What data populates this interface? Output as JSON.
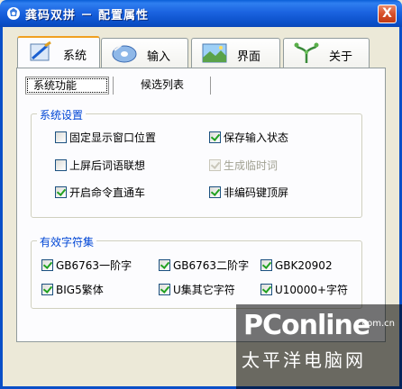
{
  "window": {
    "title": "龚码双拼 － 配置属性",
    "close_label": "X"
  },
  "tabs": [
    {
      "label": "系统",
      "icon": "pen-paper-icon",
      "active": true
    },
    {
      "label": "输入",
      "icon": "disc-icon",
      "active": false
    },
    {
      "label": "界面",
      "icon": "landscape-icon",
      "active": false
    },
    {
      "label": "关于",
      "icon": "vine-icon",
      "active": false
    }
  ],
  "subtabs": [
    {
      "label": "系统功能",
      "active": true
    },
    {
      "label": "候选列表",
      "active": false
    }
  ],
  "system_settings": {
    "title": "系统设置",
    "options": [
      {
        "label": "固定显示窗口位置",
        "checked": false,
        "enabled": true
      },
      {
        "label": "保存输入状态",
        "checked": true,
        "enabled": true
      },
      {
        "label": "上屏后词语联想",
        "checked": false,
        "enabled": true
      },
      {
        "label": "生成临时词",
        "checked": true,
        "enabled": false
      },
      {
        "label": "开启命令直通车",
        "checked": true,
        "enabled": true
      },
      {
        "label": "非编码键顶屏",
        "checked": true,
        "enabled": true
      }
    ]
  },
  "charset": {
    "title": "有效字符集",
    "options": [
      {
        "label": "GB6763一阶字",
        "checked": true
      },
      {
        "label": "GB6763二阶字",
        "checked": true
      },
      {
        "label": "GBK20902",
        "checked": true
      },
      {
        "label": "BIG5繁体",
        "checked": true
      },
      {
        "label": "U集其它字符",
        "checked": true
      },
      {
        "label": "U10000+字符",
        "checked": true
      }
    ]
  },
  "watermark": {
    "logo": "PConline",
    "domain": ".com.cn",
    "cn": "太平洋电脑网"
  }
}
